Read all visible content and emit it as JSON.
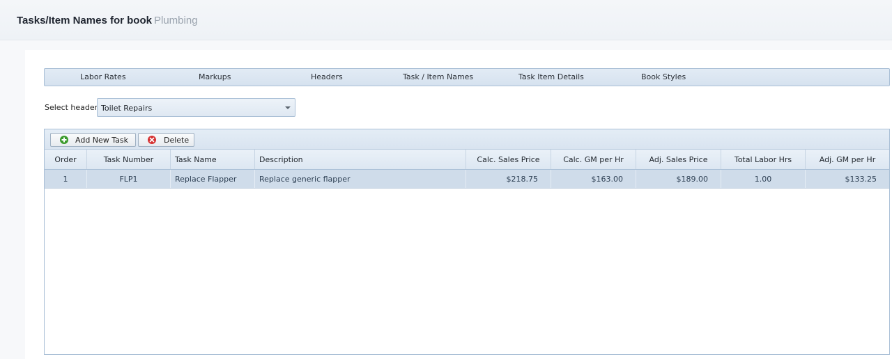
{
  "page": {
    "title": "Tasks/Item Names for book",
    "book_name": "Plumbing"
  },
  "tabs": [
    {
      "label": "Labor Rates"
    },
    {
      "label": "Markups"
    },
    {
      "label": "Headers"
    },
    {
      "label": "Task / Item Names"
    },
    {
      "label": "Task Item Details"
    },
    {
      "label": "Book Styles"
    }
  ],
  "header_select": {
    "label": "Select header:",
    "value": "Toilet Repairs"
  },
  "toolbar": {
    "add_label": "Add New Task",
    "delete_label": "Delete",
    "add_icon": "plus-circle-icon",
    "delete_icon": "x-circle-icon",
    "add_color": "#3a9a2b",
    "delete_color": "#d63232"
  },
  "table": {
    "columns": [
      "Order",
      "Task Number",
      "Task Name",
      "Description",
      "Calc. Sales Price",
      "Calc. GM per Hr",
      "Adj. Sales Price",
      "Total Labor Hrs",
      "Adj. GM per Hr"
    ],
    "rows": [
      {
        "order": "1",
        "task_number": "FLP1",
        "task_name": "Replace Flapper",
        "description": "Replace generic flapper",
        "calc_sales_price": "$218.75",
        "calc_gm_per_hr": "$163.00",
        "adj_sales_price": "$189.00",
        "total_labor_hrs": "1.00",
        "adj_gm_per_hr": "$133.25"
      }
    ]
  },
  "colors": {
    "accent": "#a9bfd6",
    "selected_row": "#cfdcea"
  }
}
